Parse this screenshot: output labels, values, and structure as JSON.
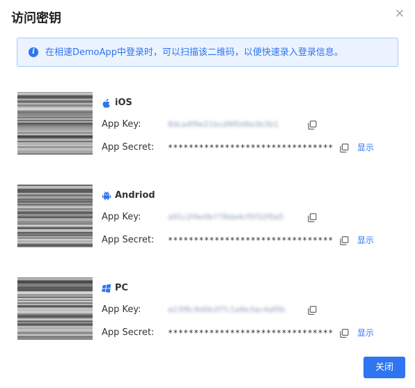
{
  "dialog": {
    "title": "访问密钥",
    "close_icon": "close-icon",
    "info": {
      "icon": "info-icon",
      "text": "在相速DemoApp中登录时，可以扫描该二维码，以便快速录入登录信息。"
    },
    "platforms": [
      {
        "name": "iOS",
        "icon": "apple-icon",
        "key_label": "App Key:",
        "key_value": "8dca4f9e21bcd9f0d9a3b3b1",
        "secret_label": "App Secret:",
        "secret_value": "********************************",
        "show_label": "显示"
      },
      {
        "name": "Andriod",
        "icon": "android-icon",
        "key_label": "App Key:",
        "key_value": "a91c2f4e0b778da4cf5f32f0a5",
        "secret_label": "App Secret:",
        "secret_value": "********************************",
        "show_label": "显示"
      },
      {
        "name": "PC",
        "icon": "windows-icon",
        "key_label": "App Key:",
        "key_value": "a23f8c9d0b2f7c1a9e3ac4af0b",
        "secret_label": "App Secret:",
        "secret_value": "********************************",
        "show_label": "显示"
      }
    ],
    "footer": {
      "close_label": "关闭"
    }
  },
  "colors": {
    "primary": "#2f74f0",
    "banner_bg": "#ebf3fe",
    "banner_border": "#a8c8f8",
    "text": "#333333"
  }
}
